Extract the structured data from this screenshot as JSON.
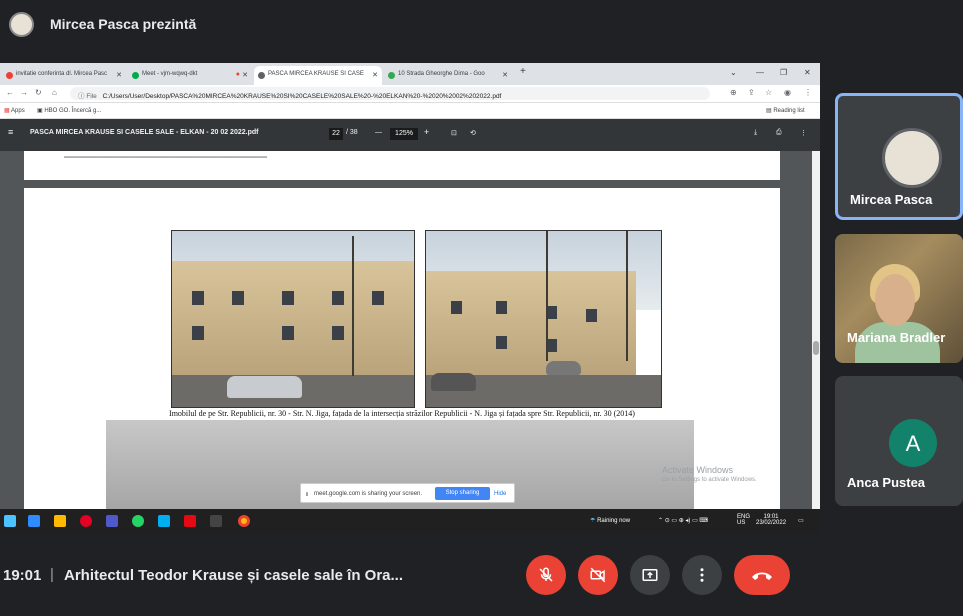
{
  "meet": {
    "presenter_banner": "Mircea Pasca prezintă",
    "time": "19:01",
    "meeting_title": "Arhitectul Teodor Krause și casele sale în Ora...",
    "participants": [
      {
        "name": "Mircea Pasca",
        "avatar": "logo"
      },
      {
        "name": "Mariana Bradler",
        "avatar": "video"
      },
      {
        "name": "Anca Pustea",
        "avatar": "A"
      }
    ],
    "controls": [
      "mic-off-icon",
      "camera-off-icon",
      "present-icon",
      "more-icon",
      "hangup-icon"
    ],
    "colors": {
      "accent_red": "#ea4335",
      "active_tile_border": "#8ab4f8",
      "avatar_green": "#12836a"
    }
  },
  "browser": {
    "tabs": [
      {
        "label": "invitatie conferinta dl. Mircea Pasc",
        "icon": "gmail-icon"
      },
      {
        "label": "Meet - vjm-wqwq-dkt",
        "icon": "meet-icon"
      },
      {
        "label": "PASCA MIRCEA KRAUSE SI CASE",
        "icon": "globe-icon"
      },
      {
        "label": "10 Strada Gheorghe Dima - Goo",
        "icon": "maps-pin-icon"
      }
    ],
    "new_tab_label": "+",
    "file_chip": "File",
    "url": "C:/Users/User/Desktop/PASCA%20MIRCEA%20KRAUSE%20SI%20CASELE%20SALE%20-%20ELKAN%20-%2020%2002%202022.pdf",
    "bookmarks": {
      "apps": "Apps",
      "hbo": "HBO GO. Încercă g...",
      "reading_list": "Reading list"
    }
  },
  "pdf": {
    "filename": "PASCA MIRCEA KRAUSE SI CASELE SALE - ELKAN - 20 02 2022.pdf",
    "page_current": "22",
    "page_total": "/ 38",
    "zoom": "125%",
    "caption": "Imobilul de pe Str. Republicii, nr. 30 - Str. N. Jiga, fațada de la intersecția străzilor Republicii - N. Jiga și fațada spre Str. Republicii, nr. 30 (2014)"
  },
  "sharing": {
    "message": "meet.google.com is sharing your screen.",
    "stop": "Stop sharing",
    "hide": "Hide"
  },
  "windows": {
    "watermark_title": "Activate Windows",
    "watermark_sub": "Go to Settings to activate Windows.",
    "weather": "Raining now",
    "lang": "ENG",
    "region": "US",
    "clock_time": "19:01",
    "clock_date": "23/02/2022"
  }
}
